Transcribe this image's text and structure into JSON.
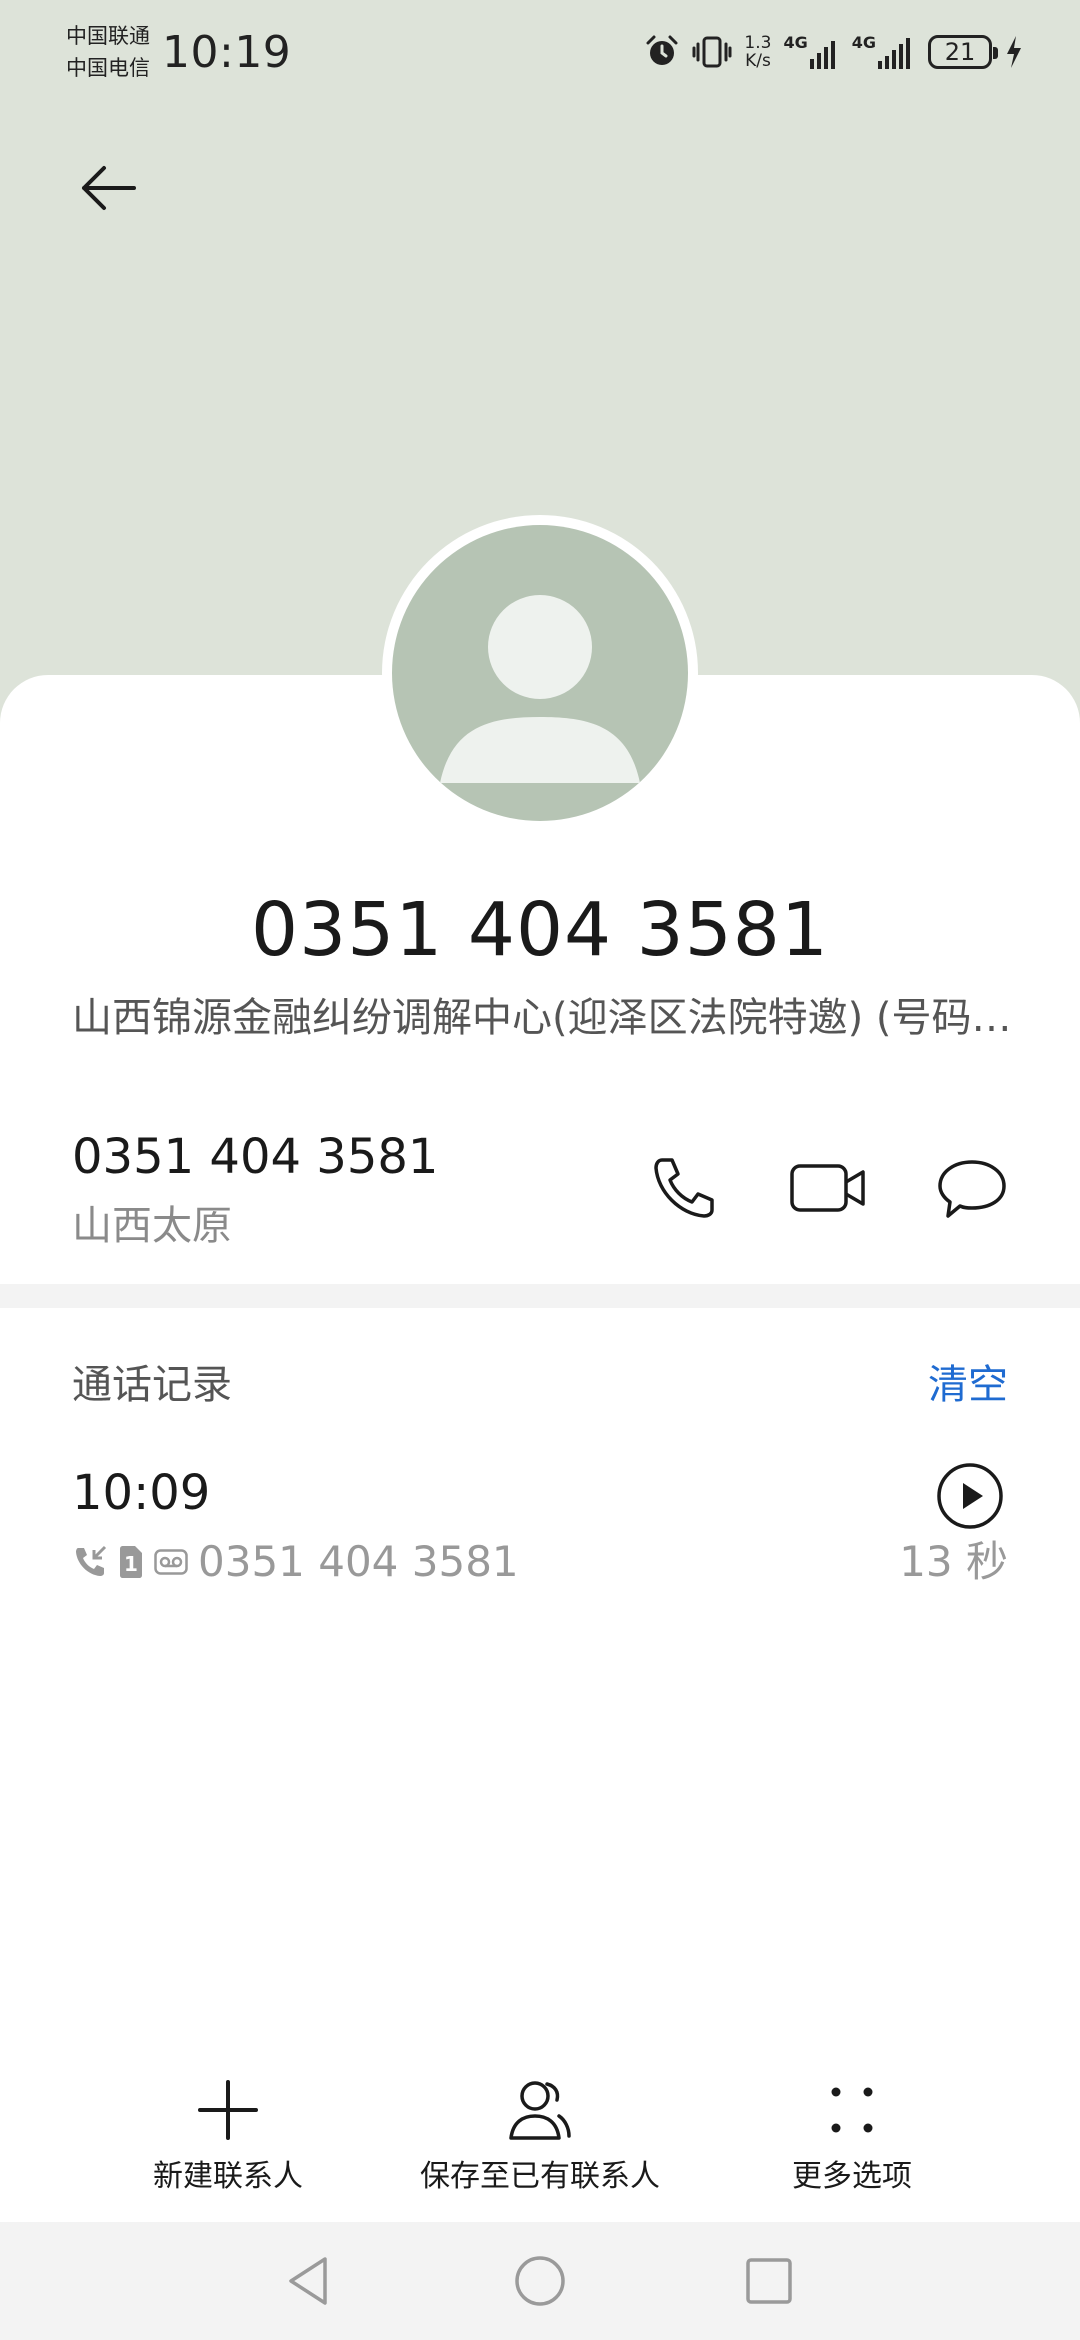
{
  "status_bar": {
    "carrier_1": "中国联通",
    "carrier_2": "中国电信",
    "time": "10:19",
    "speed_value": "1.3",
    "speed_unit": "K/s",
    "network_1": "4G",
    "network_2": "4G",
    "battery": "21"
  },
  "header": {
    "phone_number": "0351 404 3581",
    "organization": "山西锦源金融纠纷调解中心(迎泽区法院特邀) (号码标记)"
  },
  "contact": {
    "number": "0351 404 3581",
    "location": "山西太原"
  },
  "call_log": {
    "title": "通话记录",
    "clear_label": "清空",
    "entries": [
      {
        "time": "10:09",
        "number": "0351 404 3581",
        "sim": "1",
        "duration": "13 秒"
      }
    ]
  },
  "bottom_actions": {
    "new_contact": "新建联系人",
    "save_existing": "保存至已有联系人",
    "more_options": "更多选项"
  },
  "colors": {
    "header_bg": "#dde3d9",
    "avatar_bg": "#b6c4b4",
    "accent": "#1f6bd1"
  }
}
